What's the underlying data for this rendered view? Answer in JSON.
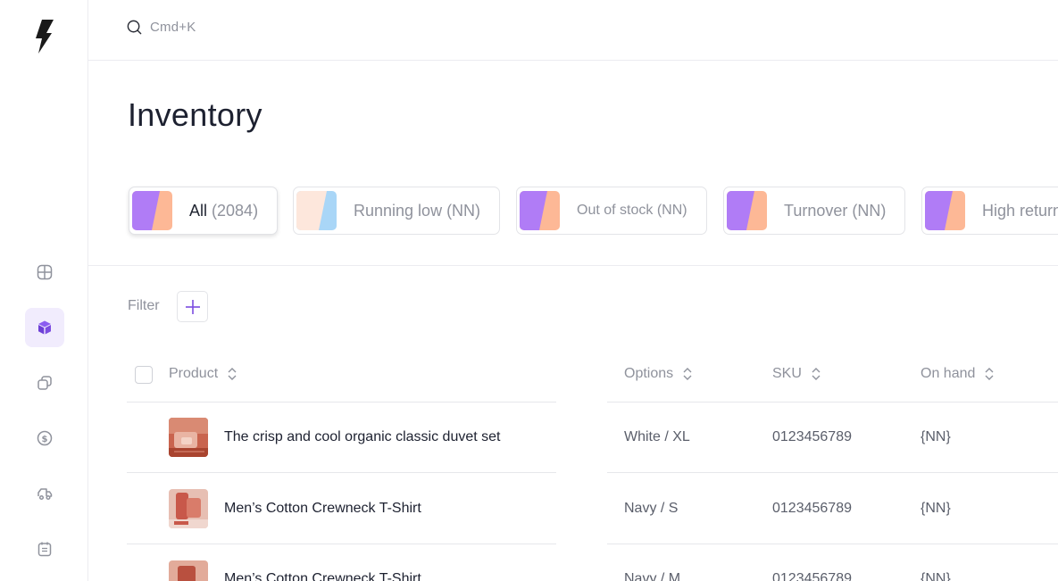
{
  "search": {
    "placeholder": "Cmd+K"
  },
  "page": {
    "title": "Inventory"
  },
  "segments": [
    {
      "name": "All",
      "count": "(2084)",
      "selected": true
    },
    {
      "label": "Running low (NN)"
    },
    {
      "label": "Out of stock (NN)"
    },
    {
      "label": "Turnover (NN)"
    },
    {
      "label": "High return"
    }
  ],
  "filter": {
    "label": "Filter"
  },
  "table": {
    "columns": [
      "Product",
      "Options",
      "SKU",
      "On hand"
    ],
    "rows": [
      {
        "product": "The crisp and cool organic classic duvet set",
        "options": "White / XL",
        "sku": "0123456789",
        "on_hand": "{NN}"
      },
      {
        "product": "Men’s Cotton Crewneck T-Shirt",
        "options": "Navy / S",
        "sku": "0123456789",
        "on_hand": "{NN}"
      },
      {
        "product": "Men’s Cotton Crewneck T-Shirt",
        "options": "Navy / M",
        "sku": "0123456789",
        "on_hand": "{NN}"
      }
    ]
  },
  "sidebar": {
    "items": [
      {
        "icon": "dashboard-grid-icon",
        "active": false
      },
      {
        "icon": "inventory-box-icon",
        "active": true
      },
      {
        "icon": "copies-icon",
        "active": false
      },
      {
        "icon": "dollar-icon",
        "active": false
      },
      {
        "icon": "truck-icon",
        "active": false
      },
      {
        "icon": "calendar-report-icon",
        "active": false
      }
    ]
  },
  "colors": {
    "accent": "#7c4ce0",
    "swatch_purple": "#b07cf6",
    "swatch_peach": "#fdb896",
    "swatch_blue": "#a9d6f7",
    "swatch_blush": "#fde7dc"
  }
}
